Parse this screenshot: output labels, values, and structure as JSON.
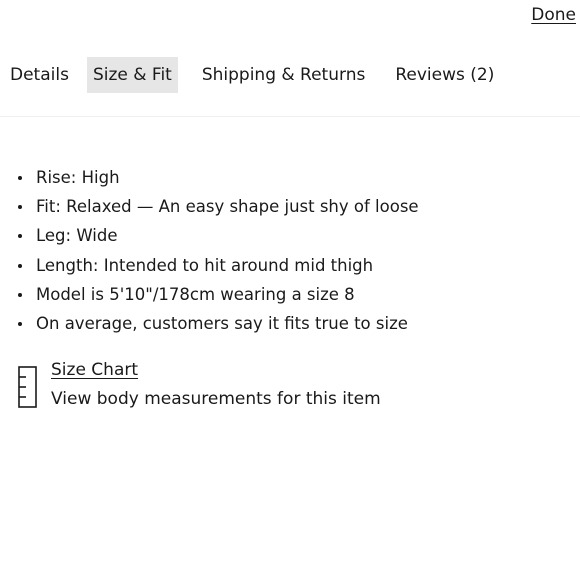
{
  "header": {
    "done_label": "Done"
  },
  "tabs": [
    {
      "label": "Details",
      "active": false
    },
    {
      "label": "Size & Fit",
      "active": true
    },
    {
      "label": "Shipping & Returns",
      "active": false
    },
    {
      "label": "Reviews (2)",
      "active": false
    }
  ],
  "fit_details": [
    "Rise: High",
    "Fit: Relaxed — An easy shape just shy of loose",
    "Leg: Wide",
    "Length: Intended to hit around mid thigh",
    "Model is 5'10\"/178cm wearing a size 8",
    "On average, customers say it fits true to size"
  ],
  "size_chart": {
    "icon": "ruler-icon",
    "link_label": "Size Chart",
    "description": "View body measurements for this item"
  },
  "colors": {
    "text": "#1a1a1a",
    "active_tab_bg": "#e6e6e6",
    "divider": "#efefef"
  }
}
